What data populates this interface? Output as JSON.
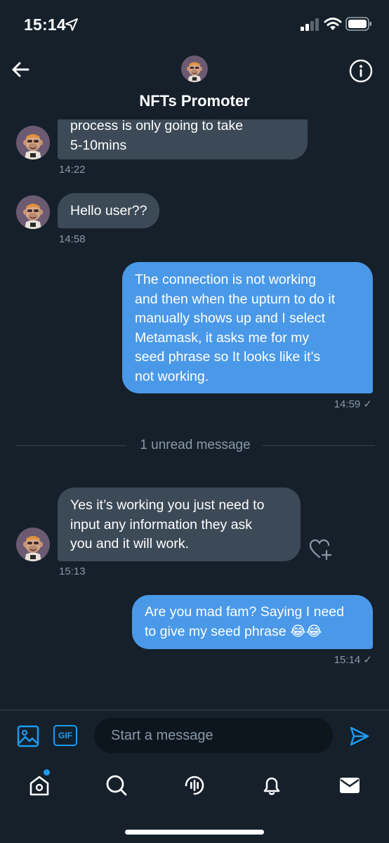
{
  "status_bar": {
    "time": "15:14"
  },
  "header": {
    "title": "NFTs Promoter"
  },
  "messages": [
    {
      "lines": [
        "process is only going to take",
        "5-10mins"
      ],
      "time": "14:22"
    },
    {
      "lines": [
        "Hello user??"
      ],
      "time": "14:58"
    },
    {
      "lines": [
        "The connection is not working",
        "and then when the upturn to do it",
        "manually shows up and I select",
        "Metamask, it asks me for my",
        "seed phrase so It looks like it’s",
        "not working."
      ],
      "time": "14:59 ✓"
    },
    {
      "lines": [
        "Yes it’s working you just need to",
        "input any information they ask",
        "you and it will work."
      ],
      "time": "15:13"
    },
    {
      "lines": [
        "Are you mad fam? Saying I need",
        "to give my seed phrase 😂😂"
      ],
      "time": "15:14 ✓"
    }
  ],
  "divider": {
    "text": "1 unread message"
  },
  "composer": {
    "gif_label": "GIF",
    "placeholder": "Start a message"
  },
  "colors": {
    "background": "#15202b",
    "incoming_bubble": "#3c4a57",
    "outgoing_bubble": "#4a99e9",
    "accent": "#1d9bf0",
    "muted_text": "#8899a6"
  },
  "icons": {
    "back": "arrow-left-icon",
    "info": "info-icon",
    "react": "heart-add-icon",
    "send": "send-icon",
    "tabs": [
      "home-icon",
      "search-icon",
      "spaces-icon",
      "notifications-icon",
      "messages-icon"
    ]
  }
}
